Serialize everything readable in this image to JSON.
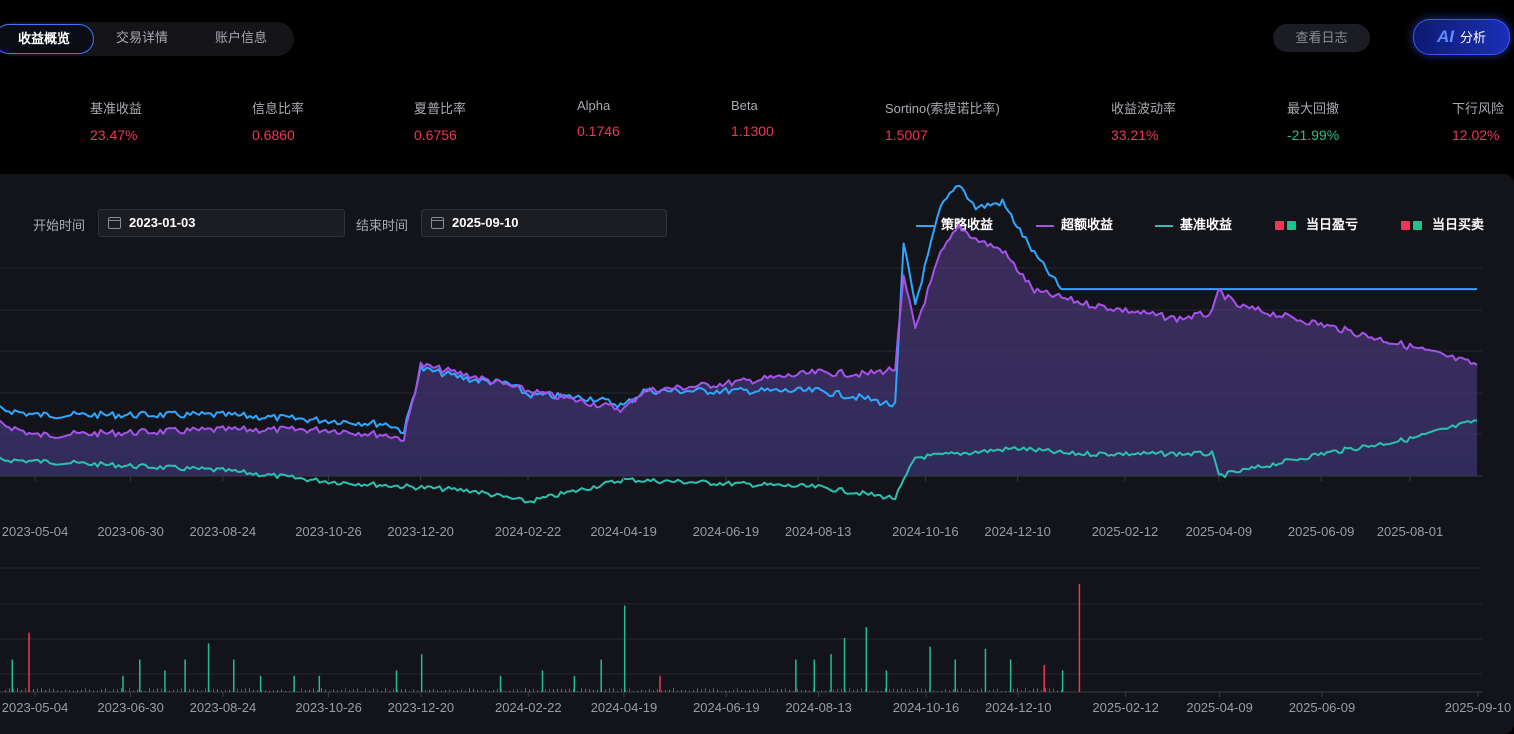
{
  "tabs": [
    {
      "label": "收益概览",
      "active": true
    },
    {
      "label": "交易详情",
      "active": false
    },
    {
      "label": "账户信息",
      "active": false
    }
  ],
  "header_buttons": {
    "log": "查看日志",
    "ai_mark": "AI",
    "ai_label": "分析"
  },
  "colors": {
    "red": "#f03556",
    "green": "#1fc08b",
    "strategy": "#2ea7ff",
    "excess": "#a552e9",
    "benchmark": "#2ac1b1"
  },
  "metrics": [
    {
      "label": "基准收益",
      "value": "23.47%",
      "color": "red"
    },
    {
      "label": "信息比率",
      "value": "0.6860",
      "color": "red"
    },
    {
      "label": "夏普比率",
      "value": "0.6756",
      "color": "red"
    },
    {
      "label": "Alpha",
      "value": "0.1746",
      "color": "red"
    },
    {
      "label": "Beta",
      "value": "1.1300",
      "color": "red"
    },
    {
      "label": "Sortino(索提诺比率)",
      "value": "1.5007",
      "color": "red"
    },
    {
      "label": "收益波动率",
      "value": "33.21%",
      "color": "red"
    },
    {
      "label": "最大回撤",
      "value": "-21.99%",
      "color": "green"
    },
    {
      "label": "下行风险",
      "value": "12.02%",
      "color": "red"
    }
  ],
  "filters": {
    "start_label": "开始时间",
    "start_value": "2023-01-03",
    "end_label": "结束时间",
    "end_value": "2025-09-10"
  },
  "legend": {
    "strategy": "策略收益",
    "excess": "超额收益",
    "benchmark": "基准收益",
    "daily_pnl": "当日盈亏",
    "daily_trade": "当日买卖"
  },
  "chart_data": [
    {
      "type": "line",
      "x_ticks": [
        "2023-05-04",
        "2023-06-30",
        "2023-08-24",
        "2023-10-26",
        "2023-12-20",
        "2024-02-22",
        "2024-04-19",
        "2024-06-19",
        "2024-08-13",
        "2024-10-16",
        "2024-12-10",
        "2025-02-12",
        "2025-04-09",
        "2025-06-09",
        "2025-08-01"
      ],
      "series": [
        {
          "name": "策略收益",
          "color": "strategy",
          "x": [
            "2023-01-03",
            "2023-04-15",
            "2023-05-04",
            "2023-08-24",
            "2023-10-26",
            "2023-12-01",
            "2023-12-10",
            "2023-12-20",
            "2024-01-20",
            "2024-02-10",
            "2024-02-22",
            "2024-04-01",
            "2024-04-19",
            "2024-05-01",
            "2024-06-19",
            "2024-08-13",
            "2024-09-10",
            "2024-09-28",
            "2024-10-03",
            "2024-10-10",
            "2024-10-25",
            "2024-11-05",
            "2024-11-15",
            "2024-12-01",
            "2024-12-20",
            "2025-01-05",
            "2025-09-10"
          ],
          "y": [
            0.36,
            0.36,
            0.33,
            0.33,
            0.3,
            0.28,
            0.24,
            0.58,
            0.52,
            0.5,
            0.44,
            0.42,
            0.38,
            0.46,
            0.46,
            0.46,
            0.42,
            0.38,
            1.25,
            0.93,
            1.45,
            1.58,
            1.45,
            1.48,
            1.2,
            1.01,
            1.01
          ]
        },
        {
          "name": "超额收益",
          "color": "excess",
          "x": [
            "2023-01-03",
            "2023-04-15",
            "2023-05-04",
            "2023-08-24",
            "2023-10-26",
            "2023-12-01",
            "2023-12-10",
            "2023-12-20",
            "2024-01-20",
            "2024-02-22",
            "2024-04-19",
            "2024-05-01",
            "2024-06-19",
            "2024-08-13",
            "2024-09-10",
            "2024-09-28",
            "2024-10-03",
            "2024-10-10",
            "2024-10-25",
            "2024-11-05",
            "2024-11-15",
            "2024-12-01",
            "2024-12-20",
            "2025-01-20",
            "2025-03-15",
            "2025-04-05",
            "2025-04-09",
            "2025-04-20",
            "2025-06-09",
            "2025-08-01",
            "2025-09-10"
          ],
          "y": [
            0.33,
            0.28,
            0.22,
            0.25,
            0.25,
            0.22,
            0.2,
            0.6,
            0.54,
            0.46,
            0.36,
            0.46,
            0.5,
            0.56,
            0.55,
            0.58,
            1.07,
            0.8,
            1.2,
            1.35,
            1.28,
            1.22,
            1.0,
            0.93,
            0.85,
            0.88,
            1.0,
            0.92,
            0.82,
            0.7,
            0.6
          ]
        },
        {
          "name": "基准收益",
          "color": "benchmark",
          "x": [
            "2023-01-03",
            "2023-05-04",
            "2023-08-24",
            "2023-10-26",
            "2024-01-20",
            "2024-02-22",
            "2024-04-19",
            "2024-06-19",
            "2024-08-13",
            "2024-09-28",
            "2024-10-10",
            "2024-12-10",
            "2025-01-10",
            "2025-04-05",
            "2025-04-09",
            "2025-06-09",
            "2025-08-01",
            "2025-09-10"
          ],
          "y": [
            0.13,
            0.08,
            0.03,
            -0.03,
            -0.08,
            -0.14,
            -0.02,
            -0.04,
            -0.06,
            -0.12,
            0.1,
            0.15,
            0.12,
            0.12,
            0.0,
            0.12,
            0.2,
            0.3
          ]
        }
      ]
    },
    {
      "type": "bar",
      "series_name": "当日买卖",
      "x_ticks": [
        "2023-05-04",
        "2023-06-30",
        "2023-08-24",
        "2023-10-26",
        "2023-12-20",
        "2024-02-22",
        "2024-04-19",
        "2024-06-19",
        "2024-08-13",
        "2024-10-16",
        "2024-12-10",
        "2025-02-12",
        "2025-04-09",
        "2025-06-09",
        "2025-09-10"
      ],
      "bars": [
        {
          "x": "2023-04-20",
          "value": 0.3,
          "color": "green"
        },
        {
          "x": "2023-04-30",
          "value": 0.55,
          "color": "red"
        },
        {
          "x": "2023-06-25",
          "value": 0.15,
          "color": "green"
        },
        {
          "x": "2023-07-05",
          "value": 0.3,
          "color": "green"
        },
        {
          "x": "2023-07-20",
          "value": 0.2,
          "color": "green"
        },
        {
          "x": "2023-08-01",
          "value": 0.3,
          "color": "green"
        },
        {
          "x": "2023-08-15",
          "value": 0.45,
          "color": "green"
        },
        {
          "x": "2023-08-30",
          "value": 0.3,
          "color": "green"
        },
        {
          "x": "2023-09-15",
          "value": 0.15,
          "color": "green"
        },
        {
          "x": "2023-10-05",
          "value": 0.15,
          "color": "green"
        },
        {
          "x": "2023-10-20",
          "value": 0.15,
          "color": "green"
        },
        {
          "x": "2023-12-05",
          "value": 0.2,
          "color": "green"
        },
        {
          "x": "2023-12-20",
          "value": 0.35,
          "color": "green"
        },
        {
          "x": "2024-02-05",
          "value": 0.15,
          "color": "green"
        },
        {
          "x": "2024-03-01",
          "value": 0.2,
          "color": "green"
        },
        {
          "x": "2024-03-20",
          "value": 0.15,
          "color": "green"
        },
        {
          "x": "2024-04-05",
          "value": 0.3,
          "color": "green"
        },
        {
          "x": "2024-04-19",
          "value": 0.8,
          "color": "green"
        },
        {
          "x": "2024-05-10",
          "value": 0.15,
          "color": "red"
        },
        {
          "x": "2024-07-30",
          "value": 0.3,
          "color": "green"
        },
        {
          "x": "2024-08-10",
          "value": 0.3,
          "color": "green"
        },
        {
          "x": "2024-08-20",
          "value": 0.35,
          "color": "green"
        },
        {
          "x": "2024-08-28",
          "value": 0.5,
          "color": "green"
        },
        {
          "x": "2024-09-10",
          "value": 0.6,
          "color": "green"
        },
        {
          "x": "2024-09-22",
          "value": 0.2,
          "color": "green"
        },
        {
          "x": "2024-10-18",
          "value": 0.42,
          "color": "green"
        },
        {
          "x": "2024-11-02",
          "value": 0.3,
          "color": "green"
        },
        {
          "x": "2024-11-20",
          "value": 0.4,
          "color": "green"
        },
        {
          "x": "2024-12-05",
          "value": 0.3,
          "color": "green"
        },
        {
          "x": "2024-12-25",
          "value": 0.25,
          "color": "red"
        },
        {
          "x": "2025-01-05",
          "value": 0.2,
          "color": "green"
        },
        {
          "x": "2025-01-15",
          "value": 1.0,
          "color": "red"
        }
      ]
    }
  ]
}
